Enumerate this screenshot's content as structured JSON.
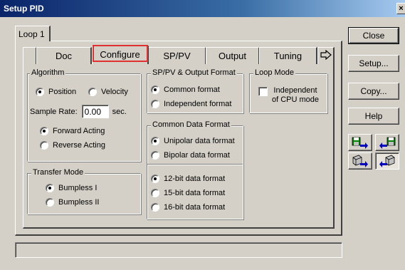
{
  "window": {
    "title": "Setup PID",
    "close_glyph": "×"
  },
  "loop_tab": {
    "label": "Loop 1"
  },
  "tabs": [
    {
      "label": "Doc"
    },
    {
      "label": "Configure"
    },
    {
      "label": "SP/PV"
    },
    {
      "label": "Output"
    },
    {
      "label": "Tuning"
    }
  ],
  "tab_scroll_icon": "arrow-right-icon",
  "algorithm": {
    "title": "Algorithm",
    "position": "Position",
    "velocity": "Velocity",
    "sample_rate_label": "Sample Rate:",
    "sample_rate_value": "0.00",
    "sample_rate_unit": "sec.",
    "forward": "Forward Acting",
    "reverse": "Reverse Acting",
    "selected_type": "position",
    "selected_action": "forward"
  },
  "transfer_mode": {
    "title": "Transfer Mode",
    "bumpless1": "Bumpless I",
    "bumpless2": "Bumpless II",
    "selected": "bumpless1"
  },
  "format": {
    "title": "SP/PV & Output Format",
    "common": "Common format",
    "independent": "Independent format",
    "selected": "common"
  },
  "loop_mode": {
    "title": "Loop Mode",
    "independent_line1": "Independent",
    "independent_line2": "of CPU mode",
    "checked": false
  },
  "common_data_format": {
    "title": "Common Data Format",
    "unipolar": "Unipolar data format",
    "bipolar": "Bipolar data format",
    "bit12": "12-bit data format",
    "bit15": "15-bit data format",
    "bit16": "16-bit data format",
    "selected_polarity": "unipolar",
    "selected_bits": "12"
  },
  "buttons": {
    "close": "Close",
    "setup": "Setup...",
    "copy": "Copy...",
    "help": "Help"
  },
  "colors": {
    "face": "#d4d0c8",
    "titlebar_start": "#0a246a",
    "titlebar_end": "#a6caf0",
    "focus_red": "#e03030",
    "icon_green": "#008000",
    "icon_blue": "#0000c0"
  }
}
